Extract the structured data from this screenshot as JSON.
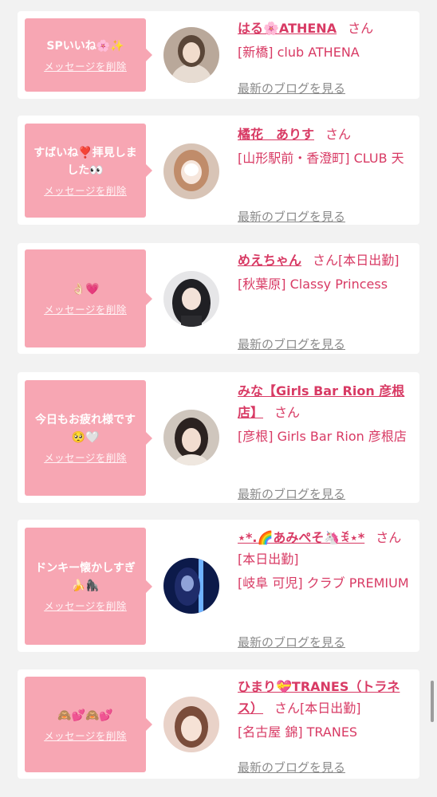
{
  "items": [
    {
      "message": "SPいいね🌸✨",
      "delete_label": "メッセージを削除",
      "name": "はる🌸ATHENA",
      "honorific": "さん",
      "status": "",
      "shop": "[新橋] club ATHENA",
      "blog_label": "最新のブログを見る"
    },
    {
      "message": "すばいね❣️拝見しました👀",
      "delete_label": "メッセージを削除",
      "name": "橘花　ありす",
      "honorific": "さん",
      "status": "",
      "shop": "[山形駅前・香澄町] CLUB 天",
      "blog_label": "最新のブログを見る"
    },
    {
      "message": "👌🏻💗",
      "delete_label": "メッセージを削除",
      "name": "めえちゃん",
      "honorific": "さん",
      "status": "[本日出勤]",
      "shop": "[秋葉原] Classy Princess",
      "blog_label": "最新のブログを見る"
    },
    {
      "message": "今日もお疲れ様です🥺🤍",
      "delete_label": "メッセージを削除",
      "name": "みな【Girls Bar Rion 彦根店】",
      "honorific": "さん",
      "status": "",
      "shop": "[彦根] Girls Bar Rion 彦根店",
      "blog_label": "最新のブログを見る"
    },
    {
      "message": "ドンキー懐かしすぎ🍌🦍",
      "delete_label": "メッセージを削除",
      "name": "⋆*.🌈あみぺそ🦄ꉂ⋆*",
      "honorific": "さん",
      "status": "[本日出勤]",
      "shop": "[岐阜 可児] クラブ PREMIUM",
      "blog_label": "最新のブログを見る"
    },
    {
      "message": "🙈💕🙈💕",
      "delete_label": "メッセージを削除",
      "name": "ひまり💝TRANES（トラネス）",
      "honorific": "さん",
      "status": "[本日出勤]",
      "shop": "[名古屋 錦] TRANES",
      "blog_label": "最新のブログを見る"
    }
  ]
}
